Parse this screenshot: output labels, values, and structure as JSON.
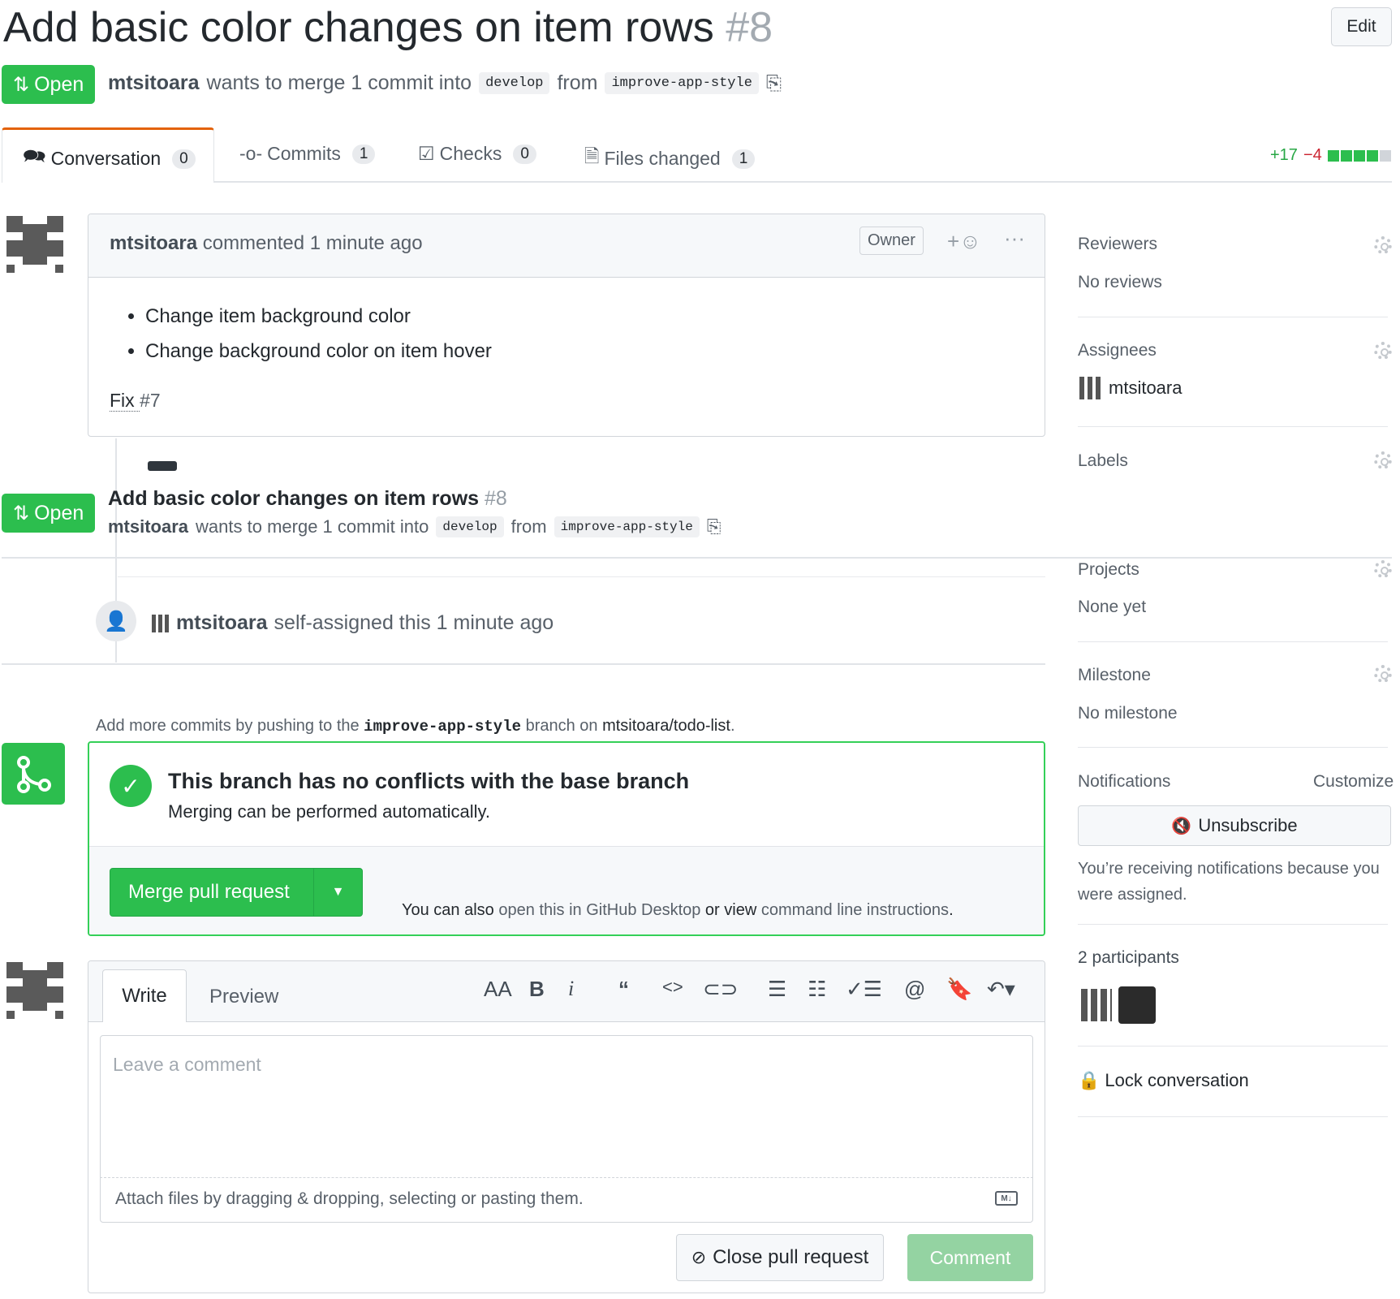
{
  "pr": {
    "title": "Add basic color changes on item rows",
    "number": "#8",
    "edit_label": "Edit",
    "state": "Open",
    "author": "mtsitoara",
    "merge_text": "wants to merge 1 commit into",
    "base_branch": "develop",
    "from_word": "from",
    "head_branch": "improve-app-style"
  },
  "tabs": [
    {
      "label": "Conversation",
      "count": "0"
    },
    {
      "label": "Commits",
      "count": "1"
    },
    {
      "label": "Checks",
      "count": "0"
    },
    {
      "label": "Files changed",
      "count": "1"
    }
  ],
  "diffstat": {
    "additions": "+17",
    "deletions": "−4"
  },
  "comment": {
    "author": "mtsitoara",
    "meta": "commented 1 minute ago",
    "role_badge": "Owner",
    "bullets": [
      "Change item background color",
      "Change background color on item hover"
    ],
    "fix_text": "Fix ",
    "fix_ref": "#7"
  },
  "ref_event": {
    "state": "Open",
    "title": "Add basic color changes on item rows",
    "number": "#8",
    "author": "mtsitoara",
    "merge_text": "wants to merge 1 commit into",
    "base_branch": "develop",
    "from_word": "from",
    "head_branch": "improve-app-style"
  },
  "assign_event": {
    "author": "mtsitoara",
    "text": "self-assigned this 1 minute ago"
  },
  "push_hint": {
    "prefix": "Add more commits by pushing to the ",
    "branch": "improve-app-style",
    "middle": " branch on ",
    "repo": "mtsitoara/todo-list",
    "suffix": "."
  },
  "merge_box": {
    "title": "This branch has no conflicts with the base branch",
    "subtitle": "Merging can be performed automatically.",
    "merge_button": "Merge pull request",
    "also_text": "You can also ",
    "desktop_link": "open this in GitHub Desktop",
    "or_text": " or view ",
    "cli_link": "command line instructions",
    "end": "."
  },
  "editor": {
    "write_tab": "Write",
    "preview_tab": "Preview",
    "placeholder": "Leave a comment",
    "attach_text": "Attach files by dragging & dropping, selecting or pasting them.",
    "close_button": "Close pull request",
    "comment_button": "Comment",
    "toolbar": [
      "AA",
      "B",
      "i",
      "“",
      "<>",
      "link",
      "ul",
      "ol",
      "task",
      "@",
      "bookmark",
      "reply"
    ]
  },
  "sidebar": {
    "reviewers_title": "Reviewers",
    "reviewers_value": "No reviews",
    "assignees_title": "Assignees",
    "assignee": "mtsitoara",
    "labels_title": "Labels",
    "projects_title": "Projects",
    "projects_value": "None yet",
    "milestone_title": "Milestone",
    "milestone_value": "No milestone",
    "notifications_title": "Notifications",
    "customize": "Customize",
    "unsubscribe": "Unsubscribe",
    "notif_reason": "You’re receiving notifications because you were assigned.",
    "participants": "2 participants",
    "lock": "Lock conversation"
  },
  "colors": {
    "green": "#2cbe4e",
    "muted": "#586069",
    "link": "#0366d6"
  }
}
